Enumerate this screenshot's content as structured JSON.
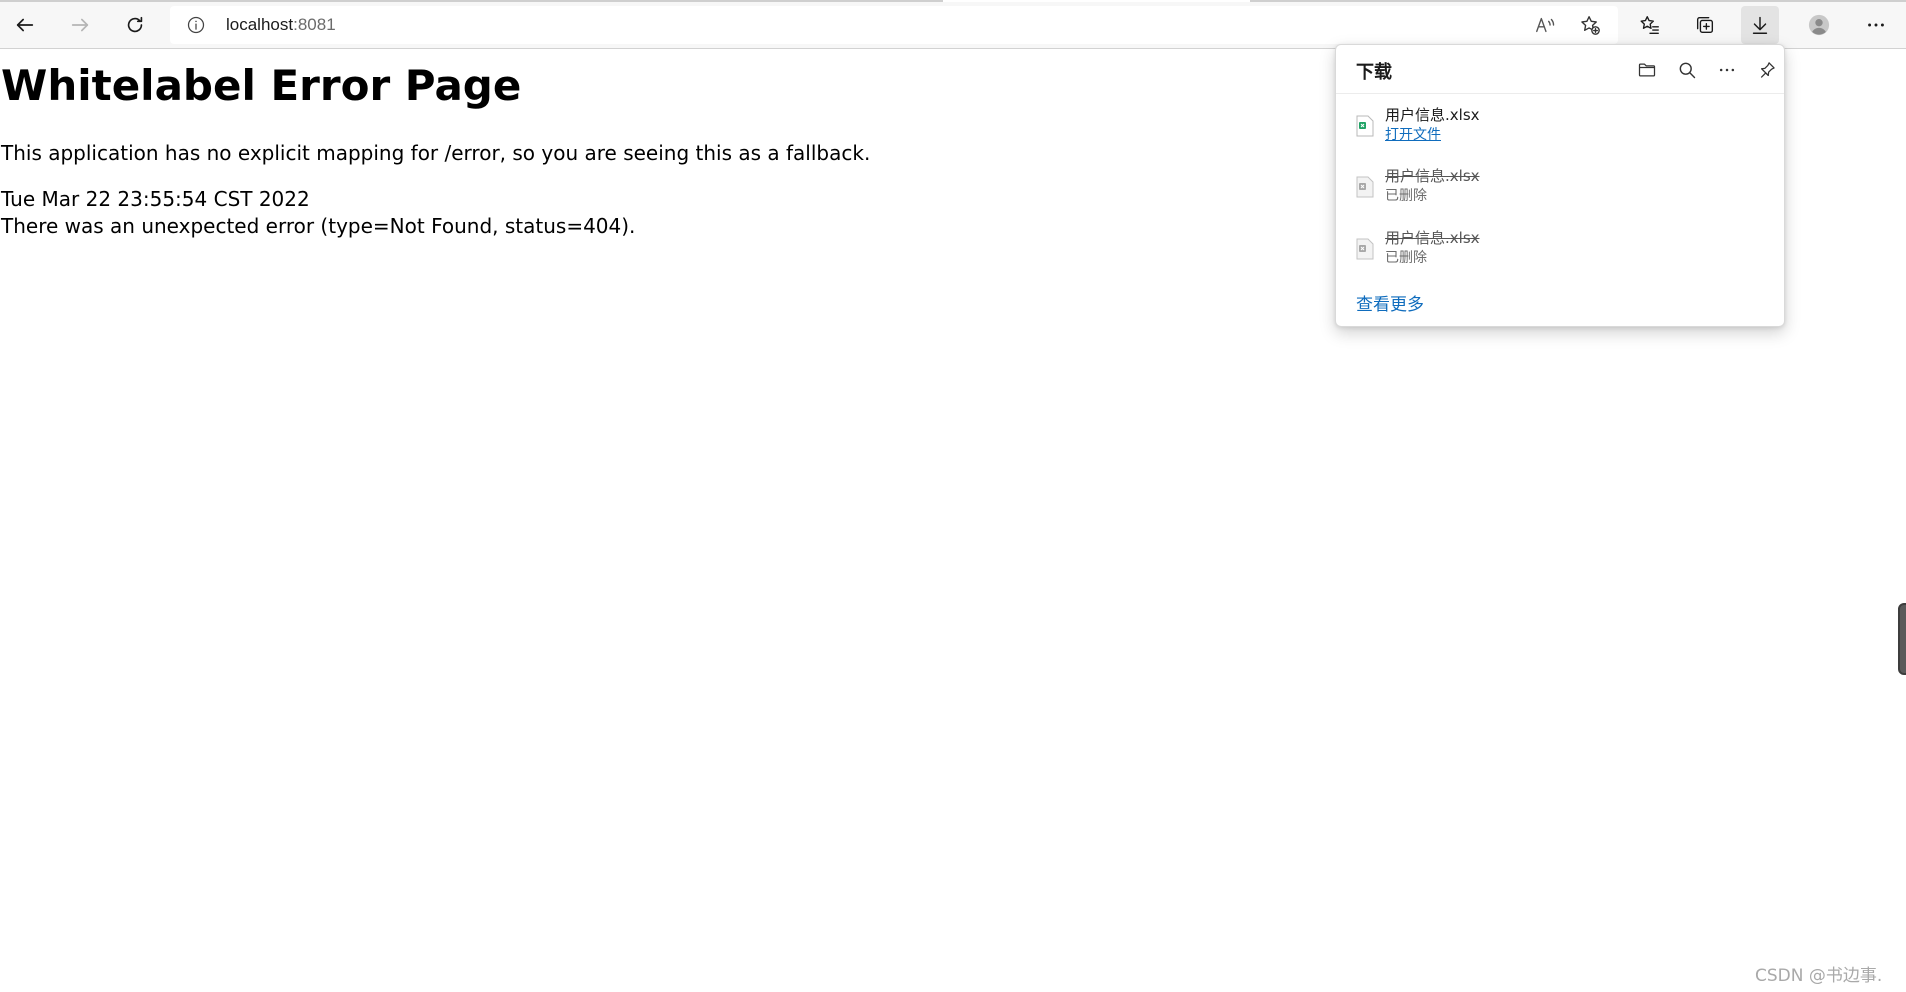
{
  "browser": {
    "url_host": "localhost",
    "url_port": ":8081"
  },
  "page": {
    "heading": "Whitelabel Error Page",
    "message": "This application has no explicit mapping for /error, so you are seeing this as a fallback.",
    "timestamp": "Tue Mar 22 23:55:54 CST 2022",
    "error_line": "There was an unexpected error (type=Not Found, status=404)."
  },
  "downloads": {
    "title": "下载",
    "items": [
      {
        "name": "用户信息.xlsx",
        "status": "打开文件",
        "deleted": false
      },
      {
        "name": "用户信息.xlsx",
        "status": "已删除",
        "deleted": true
      },
      {
        "name": "用户信息.xlsx",
        "status": "已删除",
        "deleted": true
      }
    ],
    "see_more": "查看更多"
  },
  "watermark": "CSDN @书边事.",
  "colors": {
    "link": "#0f6cbd",
    "toolbar_bg": "#f7f7f7",
    "excel_green": "#21a366"
  }
}
